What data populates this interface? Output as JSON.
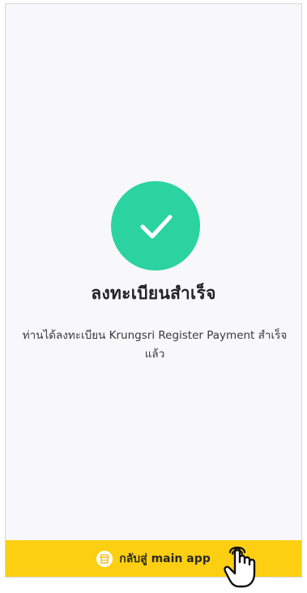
{
  "success": {
    "icon": "check-circle-icon",
    "color": "#2bd3a1",
    "title": "ลงทะเบียนสำเร็จ",
    "message": "ท่านได้ลงทะเบียน Krungsri Register Payment สำเร็จแล้ว"
  },
  "bottom_bar": {
    "color": "#fccf12",
    "icon": "store-icon",
    "label": "กลับสู่ main app"
  },
  "pointer": {
    "icon": "hand-pointer-icon"
  }
}
